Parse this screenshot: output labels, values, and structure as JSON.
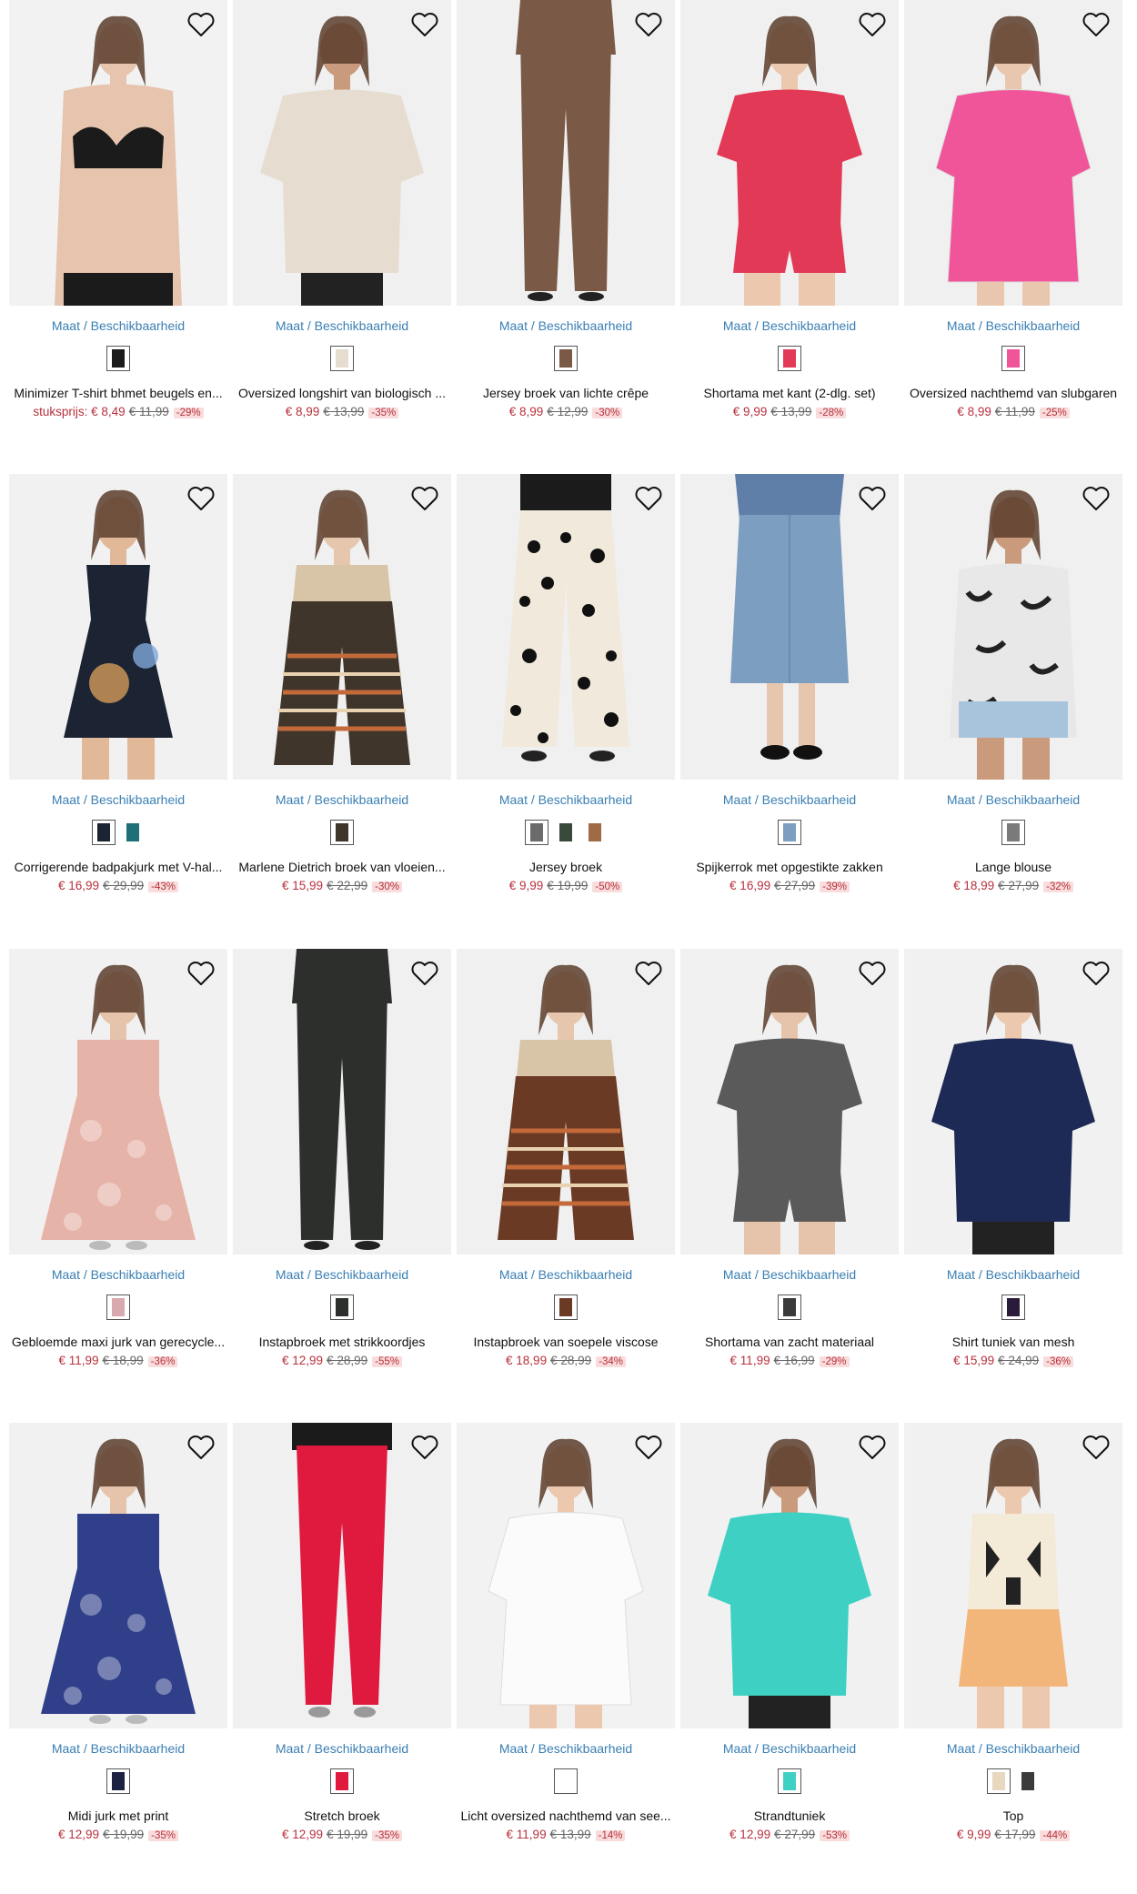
{
  "products": [
    {
      "name": "Minimizer T-shirt bhmet beugels en...",
      "prefix": "stuksprijs: ",
      "price": "€ 8,49",
      "old": "€ 11,99",
      "discount": "-29%",
      "maat": "Maat / Beschikbaarheid",
      "bg": "#f2f2f2",
      "main": "#1b1b1b",
      "skin": "#e6c4ad",
      "style": "bra",
      "swatches": [
        "#1b1b1b"
      ]
    },
    {
      "name": "Oversized longshirt van biologisch ...",
      "prefix": "",
      "price": "€ 8,99",
      "old": "€ 13,99",
      "discount": "-35%",
      "maat": "Maat / Beschikbaarheid",
      "bg": "#f0f0f0",
      "main": "#e6ddd0",
      "skin": "#c99b7c",
      "style": "tunic",
      "swatches": [
        "#e6ddd0"
      ]
    },
    {
      "name": "Jersey broek van lichte crêpe",
      "prefix": "",
      "price": "€ 8,99",
      "old": "€ 12,99",
      "discount": "-30%",
      "maat": "Maat / Beschikbaarheid",
      "bg": "#f0f0f0",
      "main": "#7a5a47",
      "skin": "#e8c6ad",
      "style": "pants",
      "swatches": [
        "#7a5a47"
      ]
    },
    {
      "name": "Shortama met kant (2-dlg. set)",
      "prefix": "",
      "price": "€ 9,99",
      "old": "€ 13,99",
      "discount": "-28%",
      "maat": "Maat / Beschikbaarheid",
      "bg": "#f0f0f0",
      "main": "#e23a56",
      "skin": "#ecc8ae",
      "style": "shortset",
      "swatches": [
        "#e23a56"
      ]
    },
    {
      "name": "Oversized nachthemd van slubgaren",
      "prefix": "",
      "price": "€ 8,99",
      "old": "€ 11,99",
      "discount": "-25%",
      "maat": "Maat / Beschikbaarheid",
      "bg": "#f0f0f0",
      "main": "#f0559a",
      "skin": "#e9c7af",
      "style": "dress",
      "swatches": [
        "#f0559a"
      ]
    },
    {
      "name": "Corrigerende badpakjurk met V-hal...",
      "prefix": "",
      "price": "€ 16,99",
      "old": "€ 29,99",
      "discount": "-43%",
      "maat": "Maat / Beschikbaarheid",
      "bg": "#f1f1f1",
      "main": "#1c2433",
      "skin": "#e1b898",
      "style": "swimdress",
      "swatches": [
        "#1c2433",
        "#1f6f78"
      ]
    },
    {
      "name": "Marlene Dietrich broek van vloeien...",
      "prefix": "",
      "price": "€ 15,99",
      "old": "€ 22,99",
      "discount": "-30%",
      "maat": "Maat / Beschikbaarheid",
      "bg": "#f0f0f0",
      "main": "#3f352b",
      "skin": "#e6c7ae",
      "style": "widepants",
      "swatches": [
        "#3f352b"
      ]
    },
    {
      "name": "Jersey broek",
      "prefix": "",
      "price": "€ 9,99",
      "old": "€ 19,99",
      "discount": "-50%",
      "maat": "Maat / Beschikbaarheid",
      "bg": "#f0f0f0",
      "main": "#f1eadc",
      "skin": "#e6c7ae",
      "style": "dotpants",
      "swatches": [
        "#6b6b6b",
        "#3a4a3a",
        "#a06a45"
      ]
    },
    {
      "name": "Spijkerrok met opgestikte zakken",
      "prefix": "",
      "price": "€ 16,99",
      "old": "€ 27,99",
      "discount": "-39%",
      "maat": "Maat / Beschikbaarheid",
      "bg": "#f0f0f0",
      "main": "#7c9ec0",
      "skin": "#e6c7ae",
      "style": "skirt",
      "swatches": [
        "#7c9ec0"
      ]
    },
    {
      "name": "Lange blouse",
      "prefix": "",
      "price": "€ 18,99",
      "old": "€ 27,99",
      "discount": "-32%",
      "maat": "Maat / Beschikbaarheid",
      "bg": "#f0f0f0",
      "main": "#e8e8e8",
      "skin": "#c99b7c",
      "style": "blouse",
      "swatches": [
        "#7a7a7a"
      ]
    },
    {
      "name": "Gebloemde maxi jurk van gerecycle...",
      "prefix": "",
      "price": "€ 11,99",
      "old": "€ 18,99",
      "discount": "-36%",
      "maat": "Maat / Beschikbaarheid",
      "bg": "#f1f1f1",
      "main": "#e6b3a8",
      "skin": "#e6c4ab",
      "style": "maxidress",
      "swatches": [
        "#d9a9b0"
      ]
    },
    {
      "name": "Instapbroek met strikkoordjes",
      "prefix": "",
      "price": "€ 12,99",
      "old": "€ 28,99",
      "discount": "-55%",
      "maat": "Maat / Beschikbaarheid",
      "bg": "#f0f0f0",
      "main": "#2c2f2c",
      "skin": "#e6c7ae",
      "style": "pants",
      "swatches": [
        "#2c2f2c"
      ]
    },
    {
      "name": "Instapbroek van soepele viscose",
      "prefix": "",
      "price": "€ 18,99",
      "old": "€ 28,99",
      "discount": "-34%",
      "maat": "Maat / Beschikbaarheid",
      "bg": "#f0f0f0",
      "main": "#6a3a24",
      "skin": "#e6c7ae",
      "style": "widepants",
      "swatches": [
        "#6a3a24"
      ]
    },
    {
      "name": "Shortama van zacht materiaal",
      "prefix": "",
      "price": "€ 11,99",
      "old": "€ 16,99",
      "discount": "-29%",
      "maat": "Maat / Beschikbaarheid",
      "bg": "#f1f1f1",
      "main": "#5a5a5a",
      "skin": "#e6c4ab",
      "style": "shortset",
      "swatches": [
        "#3a3a3a"
      ]
    },
    {
      "name": "Shirt tuniek van mesh",
      "prefix": "",
      "price": "€ 15,99",
      "old": "€ 24,99",
      "discount": "-36%",
      "maat": "Maat / Beschikbaarheid",
      "bg": "#f1f1f1",
      "main": "#1d2a55",
      "skin": "#ecc8ae",
      "style": "tunic",
      "swatches": [
        "#2a1b3a"
      ]
    },
    {
      "name": "Midi jurk met print",
      "prefix": "",
      "price": "€ 12,99",
      "old": "€ 19,99",
      "discount": "-35%",
      "maat": "Maat / Beschikbaarheid",
      "bg": "#f1f1f1",
      "main": "#2f3f8a",
      "skin": "#e6c4ab",
      "style": "maxidress",
      "swatches": [
        "#1c2240"
      ]
    },
    {
      "name": "Stretch broek",
      "prefix": "",
      "price": "€ 12,99",
      "old": "€ 19,99",
      "discount": "-35%",
      "maat": "Maat / Beschikbaarheid",
      "bg": "#f0f0f0",
      "main": "#e0193e",
      "skin": "#e6c7ae",
      "style": "slimpants",
      "swatches": [
        "#e0193e"
      ]
    },
    {
      "name": "Licht oversized nachthemd van see...",
      "prefix": "",
      "price": "€ 11,99",
      "old": "€ 13,99",
      "discount": "-14%",
      "maat": "Maat / Beschikbaarheid",
      "bg": "#f2f2f2",
      "main": "#fbfbfb",
      "skin": "#ecc8ae",
      "style": "dress",
      "swatches": [
        "#ffffff"
      ]
    },
    {
      "name": "Strandtuniek",
      "prefix": "",
      "price": "€ 12,99",
      "old": "€ 27,99",
      "discount": "-53%",
      "maat": "Maat / Beschikbaarheid",
      "bg": "#f1f1f1",
      "main": "#3fd0c4",
      "skin": "#c99b7c",
      "style": "tunic",
      "swatches": [
        "#3fd0c4"
      ]
    },
    {
      "name": "Top",
      "prefix": "",
      "price": "€ 9,99",
      "old": "€ 17,99",
      "discount": "-44%",
      "maat": "Maat / Beschikbaarheid",
      "bg": "#f1f1f1",
      "main": "#f3b67a",
      "skin": "#ecc8ae",
      "style": "top",
      "swatches": [
        "#e8d8c0",
        "#3b3b3b"
      ]
    }
  ]
}
